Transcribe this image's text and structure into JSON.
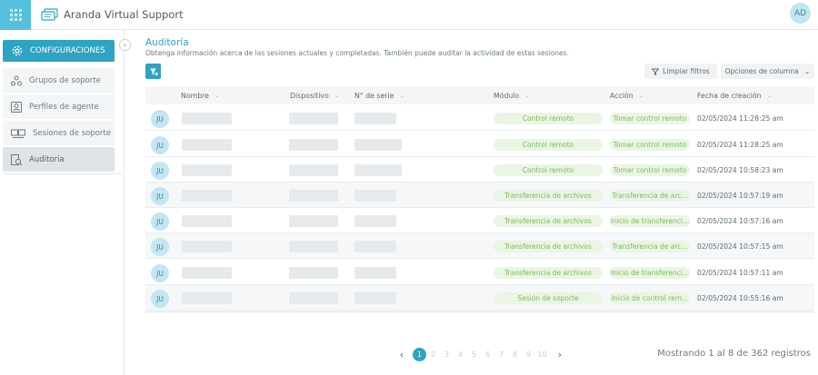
{
  "app": {
    "title": "Aranda Virtual Support",
    "brand_prefix": "Aranda",
    "brand_suffix": "Virtual Support",
    "user_initials": "AD"
  },
  "colors": {
    "accent": "#2ea3c4",
    "status_green": "#7cba5a",
    "pill_bg": "#eaf5e4"
  },
  "sidebar": {
    "header_label": "CONFIGURACIONES",
    "collapse_icon": "chevron-right-icon",
    "items": [
      {
        "label": "Grupos de soporte",
        "icon": "group-icon",
        "active": false
      },
      {
        "label": "Perfiles de agente",
        "icon": "agent-profile-icon",
        "active": false
      },
      {
        "label": "Sesiones de soporte",
        "icon": "sessions-icon",
        "active": false
      },
      {
        "label": "Auditoría",
        "icon": "audit-icon",
        "active": true
      }
    ]
  },
  "main": {
    "title": "Auditoría",
    "subtitle": "Obtenga información acerca de las sesiones actuales y completadas. También puede auditar la actividad de estas sesiones.",
    "clear_filters_label": "Limpiar filtros",
    "column_options_label": "Opciones de columna"
  },
  "table": {
    "columns": [
      "Nombre",
      "Dispositivo",
      "N° de serie",
      "Módulo",
      "Acción",
      "Fecha de creación"
    ],
    "rows": [
      {
        "initials": "JU",
        "module": "Control remoto",
        "action": "Tomar control remoto",
        "date": "02/05/2024 11:28:25 am"
      },
      {
        "initials": "JU",
        "module": "Control remoto",
        "action": "Tomar control remoto",
        "date": "02/05/2024 11:28:25 am"
      },
      {
        "initials": "JU",
        "module": "Control remoto",
        "action": "Tomar control remoto",
        "date": "02/05/2024 10:58:23 am"
      },
      {
        "initials": "JU",
        "module": "Transferencia de archivos",
        "action": "Transferencia de arc...",
        "date": "02/05/2024 10:57:19 am"
      },
      {
        "initials": "JU",
        "module": "Transferencia de archivos",
        "action": "Inicio de transferenci...",
        "date": "02/05/2024 10:57:16 am"
      },
      {
        "initials": "JU",
        "module": "Transferencia de archivos",
        "action": "Transferencia de arc...",
        "date": "02/05/2024 10:57:15 am"
      },
      {
        "initials": "JU",
        "module": "Transferencia de archivos",
        "action": "Inicio de transferenci...",
        "date": "02/05/2024 10:57:11 am"
      },
      {
        "initials": "JU",
        "module": "Sesión de soporte",
        "action": "Inicio de control rem...",
        "date": "02/05/2024 10:55:16 am"
      }
    ]
  },
  "pagination": {
    "pages": [
      "1",
      "2",
      "3",
      "4",
      "5",
      "6",
      "7",
      "8",
      "9",
      "10"
    ],
    "current": "1",
    "prev_icon": "chevron-left-icon",
    "next_icon": "chevron-right-icon",
    "records_text": "Mostrando 1 al 8 de 362 registros"
  }
}
